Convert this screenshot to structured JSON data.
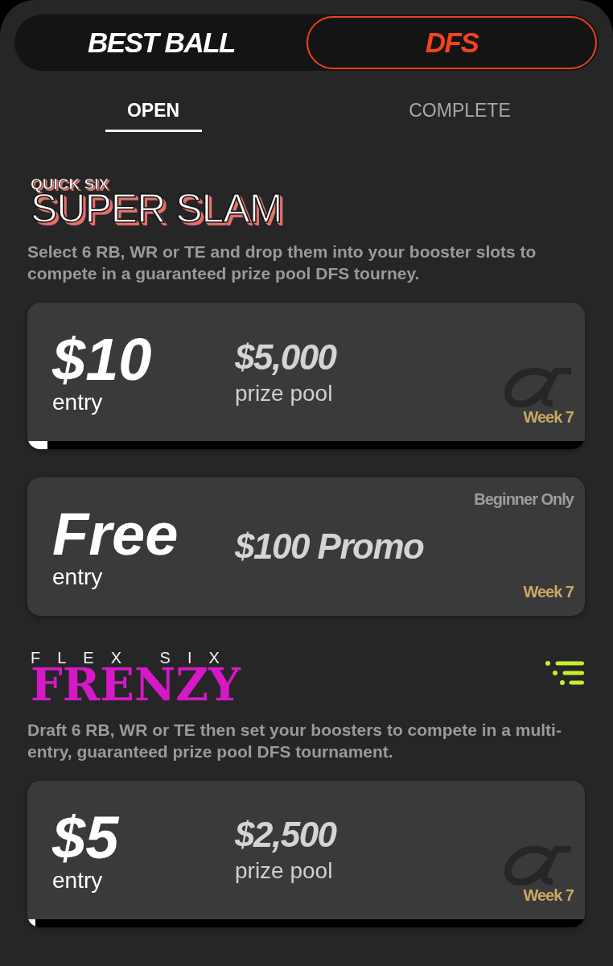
{
  "mode_tabs": [
    {
      "label": "BEST BALL",
      "selected": false
    },
    {
      "label": "DFS",
      "selected": true
    }
  ],
  "status_tabs": [
    {
      "label": "OPEN",
      "selected": true
    },
    {
      "label": "COMPLETE",
      "selected": false
    }
  ],
  "sections": [
    {
      "kind": "super_slam",
      "logo_top": "QUICK SIX",
      "logo_main": "SUPER SLAM",
      "description": "Select 6 RB, WR or TE and drop them into your booster slots to compete in a guaranteed prize pool DFS tourney.",
      "contests": [
        {
          "entry": "$10",
          "entry_label": "entry",
          "prize": "$5,000",
          "prize_label": "prize pool",
          "week": "Week 7",
          "alpha_mark": true,
          "level": 0.036
        },
        {
          "entry": "Free",
          "entry_label": "entry",
          "prize": "$100 Promo",
          "eligibility": "Beginner Only",
          "week": "Week 7"
        }
      ]
    },
    {
      "kind": "frenzy",
      "logo_top": "FLEX SIX",
      "logo_main": "FRENZY",
      "filter_button": true,
      "description": "Draft 6 RB, WR or TE then set your boosters to compete in a multi-entry, guaranteed prize pool DFS tournament.",
      "contests": [
        {
          "entry": "$5",
          "entry_label": "entry",
          "prize": "$2,500",
          "prize_label": "prize pool",
          "week": "Week 7",
          "alpha_mark": true,
          "level": 0.014
        }
      ]
    }
  ]
}
